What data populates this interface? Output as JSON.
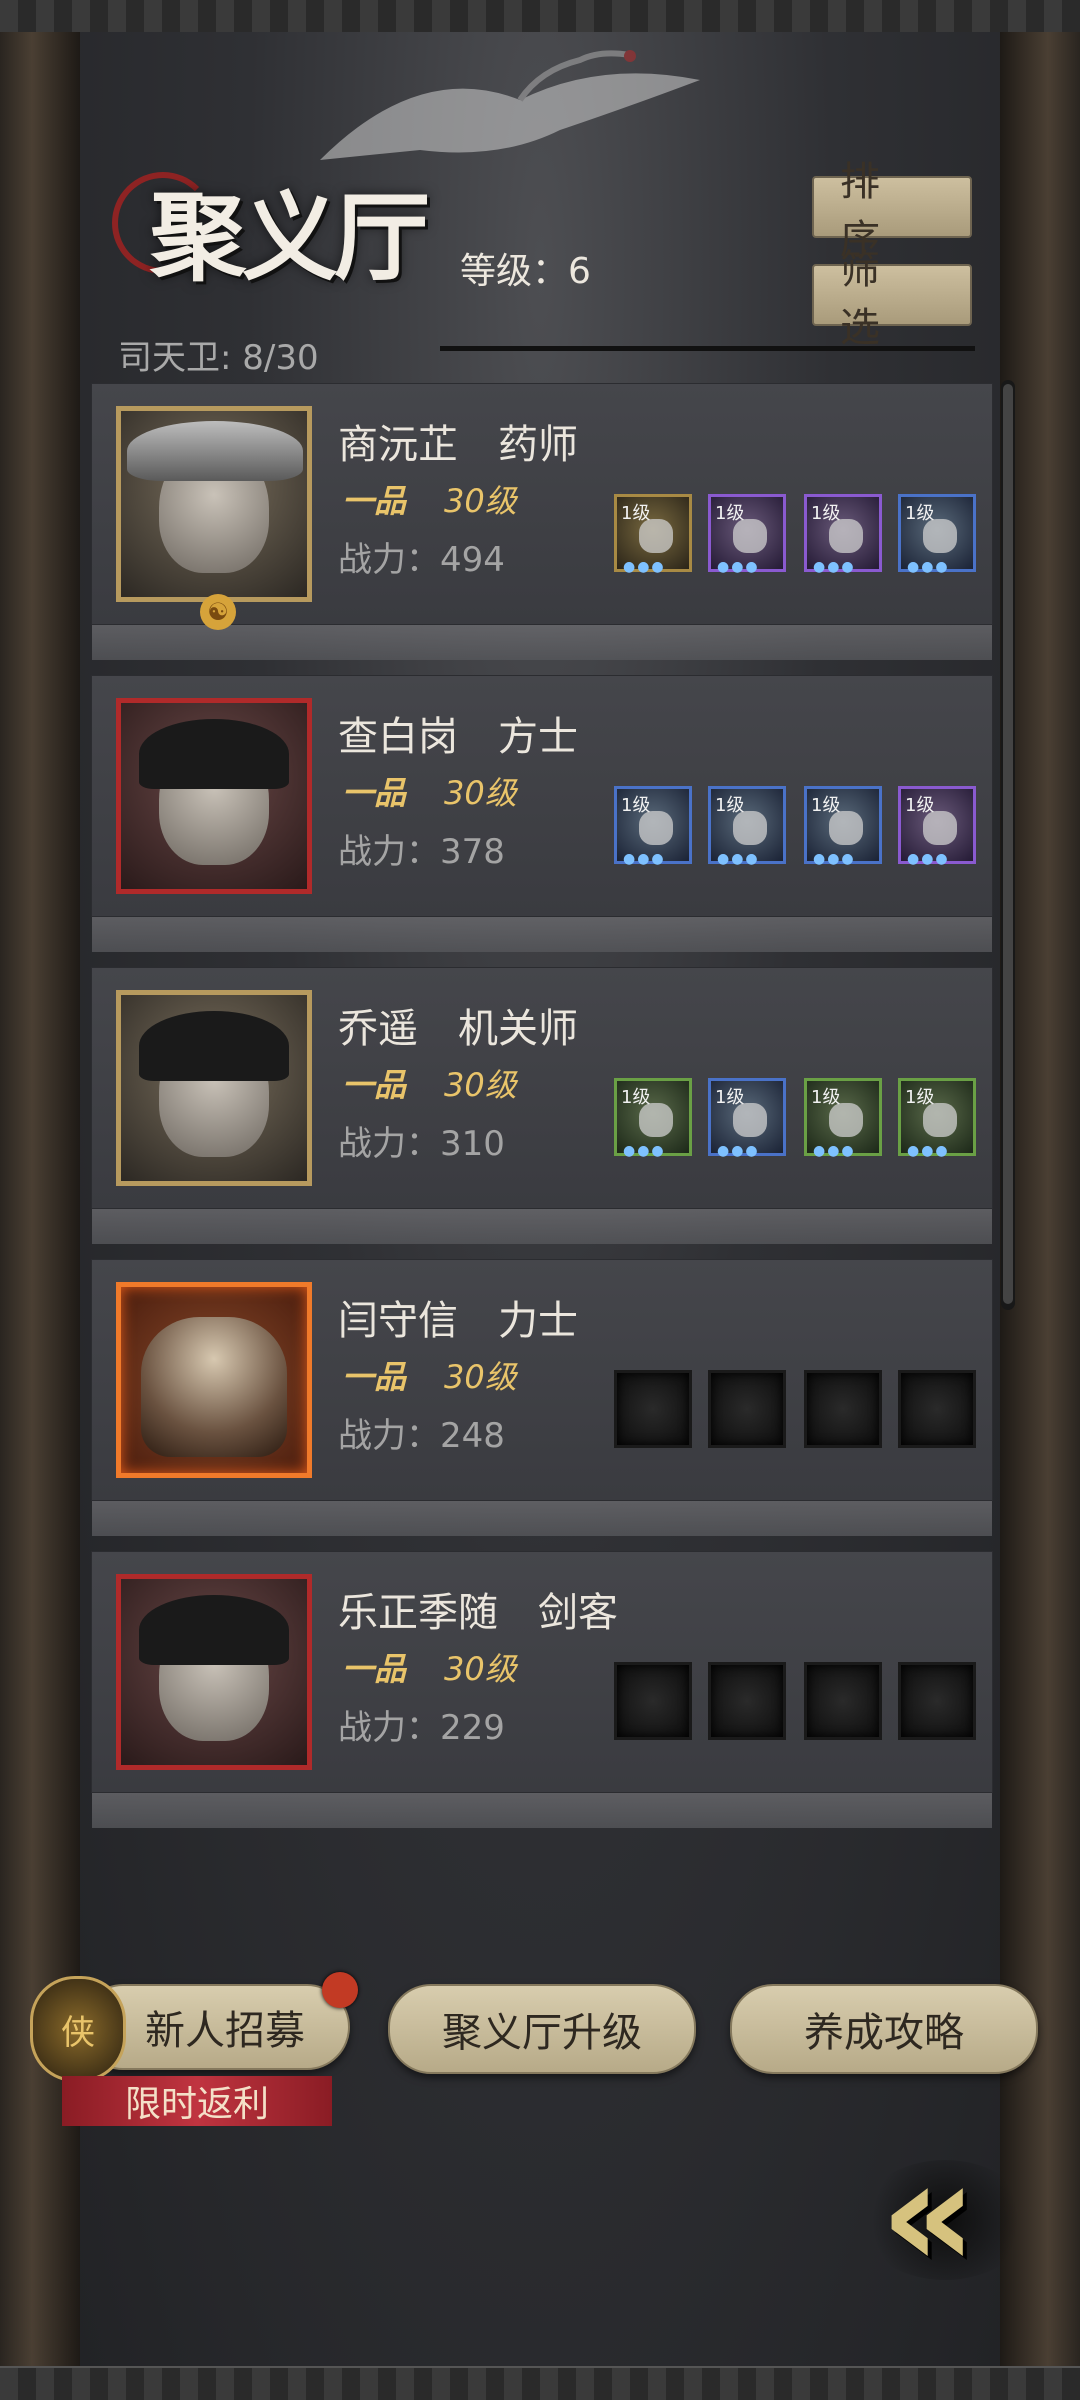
{
  "header": {
    "title": "聚义厅",
    "level_label": "等级：6",
    "sort_label": "排序",
    "filter_label": "筛选",
    "guard_count": "司天卫: 8/30"
  },
  "heroes": [
    {
      "name": "商沅芷　药师",
      "rank": "一品",
      "level": "30级",
      "power": "战力：494",
      "slots": [
        {
          "level": "1级",
          "rarity": "gold",
          "icon": "gourd-icon"
        },
        {
          "level": "1级",
          "rarity": "purple",
          "icon": "robe-icon"
        },
        {
          "level": "1级",
          "rarity": "purple",
          "icon": "gauntlet-icon"
        },
        {
          "level": "1级",
          "rarity": "blue",
          "icon": "pouch-icon"
        }
      ]
    },
    {
      "name": "查白岗　方士",
      "rank": "一品",
      "level": "30级",
      "power": "战力：378",
      "slots": [
        {
          "level": "1级",
          "rarity": "blue",
          "icon": "blade-icon"
        },
        {
          "level": "1级",
          "rarity": "blue",
          "icon": "armor-icon"
        },
        {
          "level": "1级",
          "rarity": "blue",
          "icon": "compass-icon"
        },
        {
          "level": "1级",
          "rarity": "purple",
          "icon": "fang-icon"
        }
      ]
    },
    {
      "name": "乔遥　机关师",
      "rank": "一品",
      "level": "30级",
      "power": "战力：310",
      "slots": [
        {
          "level": "1级",
          "rarity": "green",
          "icon": "crossbow-icon"
        },
        {
          "level": "1级",
          "rarity": "blue",
          "icon": "robe-icon"
        },
        {
          "level": "1级",
          "rarity": "green",
          "icon": "coin-necklace-icon"
        },
        {
          "level": "1级",
          "rarity": "green",
          "icon": "coin-necklace-icon"
        }
      ]
    },
    {
      "name": "闫守信　力士",
      "rank": "一品",
      "level": "30级",
      "power": "战力：248",
      "slots": [
        {
          "level": "",
          "rarity": "empty"
        },
        {
          "level": "",
          "rarity": "empty"
        },
        {
          "level": "",
          "rarity": "empty"
        },
        {
          "level": "",
          "rarity": "empty"
        }
      ]
    },
    {
      "name": "乐正季随　剑客",
      "rank": "一品",
      "level": "30级",
      "power": "战力：229",
      "slots": [
        {
          "level": "",
          "rarity": "empty"
        },
        {
          "level": "",
          "rarity": "empty"
        },
        {
          "level": "",
          "rarity": "empty"
        },
        {
          "level": "",
          "rarity": "empty"
        }
      ]
    }
  ],
  "footer": {
    "recruit_label": "新人招募",
    "upgrade_label": "聚义厅升级",
    "guide_label": "养成攻略",
    "promo_label": "限时返利",
    "recruit_icon_glyph": "侠",
    "back_icon": "double-chevron-left-icon"
  },
  "colors": {
    "accent_gold": "#e9c46a",
    "promo_red": "#c03440"
  }
}
